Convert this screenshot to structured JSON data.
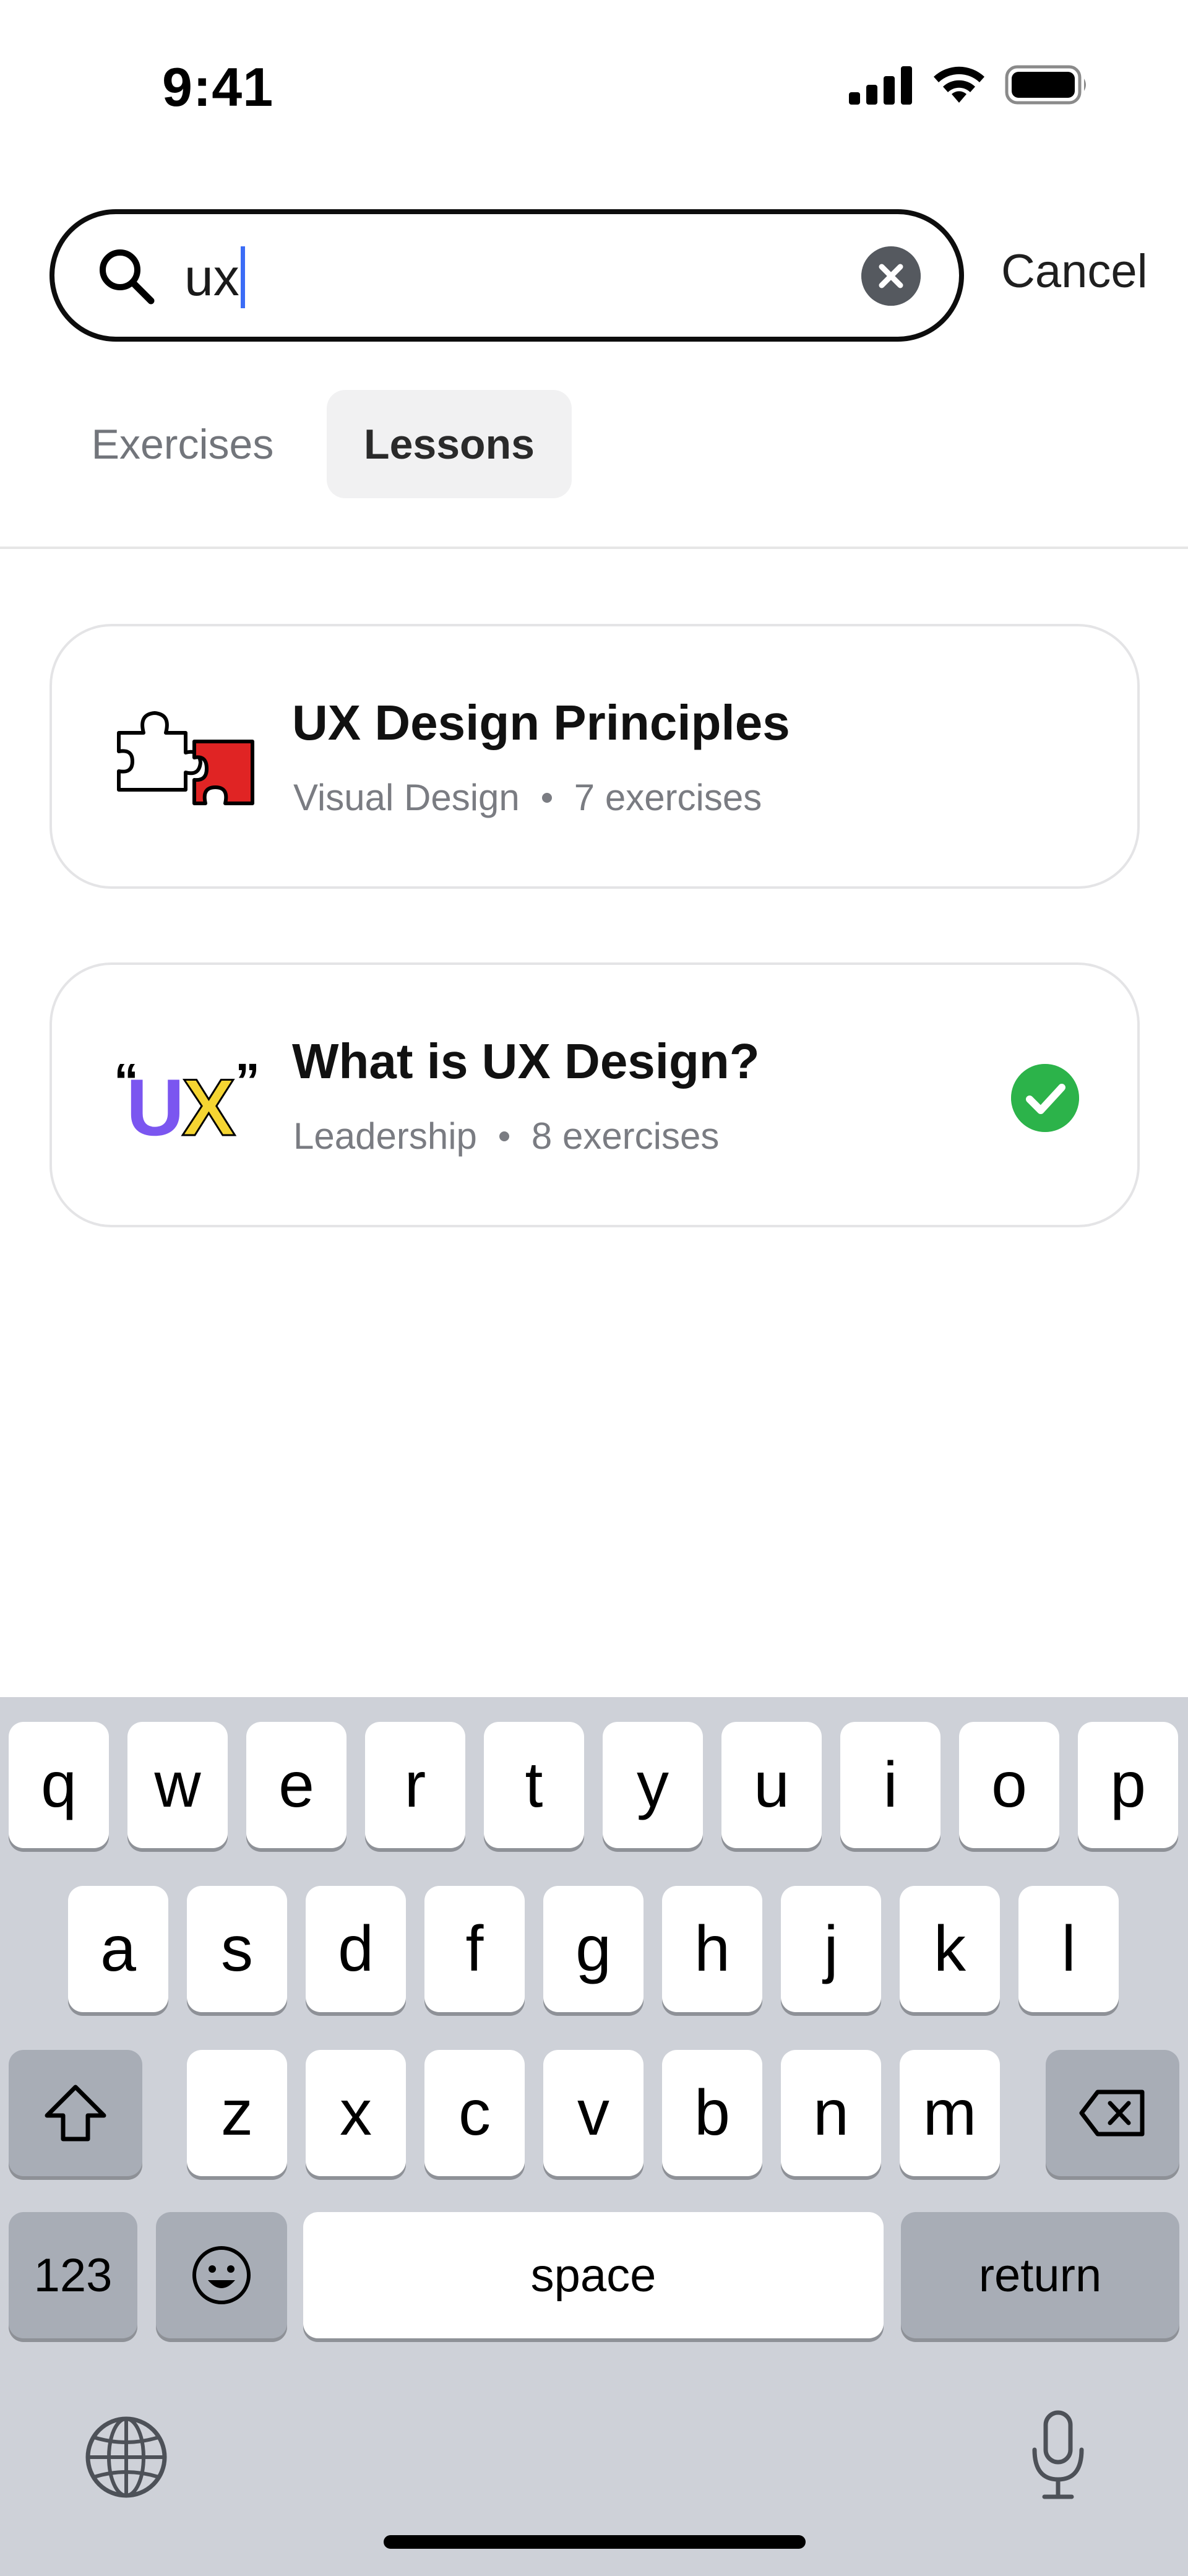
{
  "status_bar": {
    "time": "9:41",
    "icons": [
      "cellular-signal-icon",
      "wifi-icon",
      "battery-icon"
    ]
  },
  "search": {
    "value": "ux",
    "cancel_label": "Cancel",
    "icons": [
      "search-icon",
      "clear-icon"
    ]
  },
  "tabs": [
    {
      "label": "Exercises",
      "selected": false
    },
    {
      "label": "Lessons",
      "selected": true
    }
  ],
  "results": [
    {
      "title": "UX Design Principles",
      "category": "Visual Design",
      "count": "7 exercises",
      "thumbnail_icon": "puzzle-icon",
      "completed": false
    },
    {
      "title": "What is UX Design?",
      "category": "Leadership",
      "count": "8 exercises",
      "thumbnail_icon": "ux-quote-icon",
      "thumbnail_text": {
        "open_quote": "“",
        "u": "U",
        "x": "X",
        "close_quote": "”"
      },
      "completed": true
    }
  ],
  "keyboard": {
    "row1": [
      "q",
      "w",
      "e",
      "r",
      "t",
      "y",
      "u",
      "i",
      "o",
      "p"
    ],
    "row2": [
      "a",
      "s",
      "d",
      "f",
      "g",
      "h",
      "j",
      "k",
      "l"
    ],
    "row3": [
      "z",
      "x",
      "c",
      "v",
      "b",
      "n",
      "m"
    ],
    "numbers_label": "123",
    "space_label": "space",
    "return_label": "return",
    "icons": [
      "shift-icon",
      "backspace-icon",
      "emoji-icon",
      "globe-icon",
      "microphone-icon"
    ]
  },
  "colors": {
    "accent_caret": "#3b6cf6",
    "check_green": "#2cb34a",
    "puzzle_red": "#e02424",
    "ux_purple": "#7b56f0",
    "ux_yellow": "#f5d532"
  }
}
